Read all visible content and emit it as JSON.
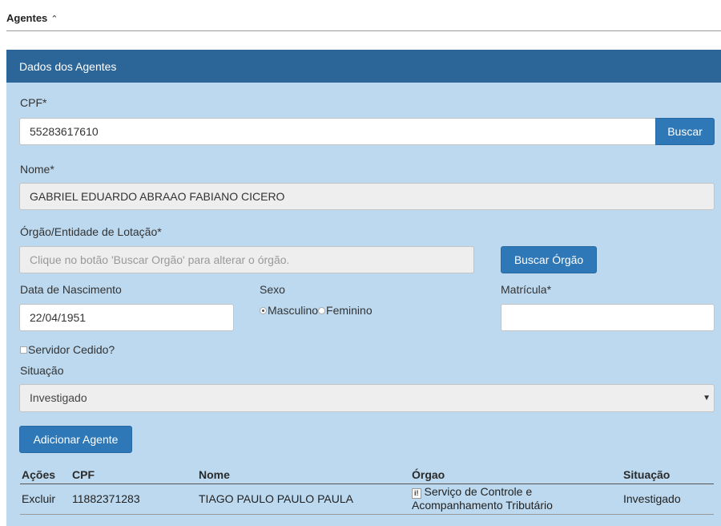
{
  "section": {
    "title": "Agentes",
    "toggle_icon": "double-chevron-up"
  },
  "panel": {
    "heading": "Dados dos Agentes"
  },
  "cpf": {
    "label": "CPF*",
    "value": "55283617610",
    "button": "Buscar"
  },
  "nome": {
    "label": "Nome*",
    "value": "GABRIEL EDUARDO ABRAAO FABIANO CICERO"
  },
  "orgao": {
    "label": "Órgão/Entidade de Lotação*",
    "placeholder": "Clique no botão 'Buscar Orgão' para alterar o órgão.",
    "button": "Buscar Órgão"
  },
  "nascimento": {
    "label": "Data de Nascimento",
    "value": "22/04/1951"
  },
  "sexo": {
    "label": "Sexo",
    "options": [
      "Masculino",
      "Feminino"
    ],
    "selected": "Masculino"
  },
  "matricula": {
    "label": "Matrícula*",
    "value": ""
  },
  "cedido": {
    "label": "Servidor Cedido?",
    "checked": false
  },
  "situacao": {
    "label": "Situação",
    "selected": "Investigado"
  },
  "add_button": "Adicionar Agente",
  "table": {
    "headers": [
      "Ações",
      "CPF",
      "Nome",
      "Órgao",
      "Situação"
    ],
    "rows": [
      {
        "action": "Excluir",
        "cpf": "11882371283",
        "nome": "TIAGO PAULO PAULO PAULA",
        "orgao_line1": "Serviço de Controle e",
        "orgao_line2": "Acompanhamento Tributário",
        "situacao": "Investigado"
      }
    ]
  }
}
